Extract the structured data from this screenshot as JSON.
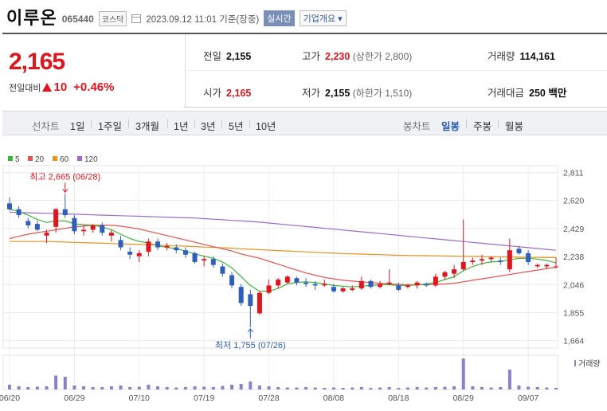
{
  "header": {
    "name": "이루온",
    "code": "065440",
    "market": "코스닥",
    "datetime": "2023.09.12 11:01 기준(장중)",
    "realtime_label": "실시간",
    "company_label": "기업개요 ▾"
  },
  "summary": {
    "price": "2,165",
    "change_label": "전일대비",
    "change_amount": "10",
    "change_percent": "+0.46%",
    "prev_close_label": "전일",
    "prev_close": "2,155",
    "high_label": "고가",
    "high": "2,230",
    "upper_limit": "(상한가 2,800)",
    "volume_label": "거래량",
    "volume": "114,161",
    "open_label": "시가",
    "open": "2,165",
    "low_label": "저가",
    "low": "2,155",
    "lower_limit": "(하한가 1,510)",
    "trade_value_label": "거래대금",
    "trade_value": "250 백만"
  },
  "period_bar": {
    "line_label": "선차트",
    "line_periods": [
      "1일",
      "1주일",
      "3개월",
      "1년",
      "3년",
      "5년",
      "10년"
    ],
    "candle_label": "봉차트",
    "candle_periods": [
      "일봉",
      "주봉",
      "월봉"
    ],
    "active_candle": "일봉"
  },
  "colors": {
    "up": "#e0151d",
    "down": "#2f5fb8",
    "ma5": "#3cb43c",
    "ma20": "#e8524f",
    "ma60": "#e8941e",
    "ma120": "#9b6ad0",
    "volume": "#8e80c4"
  },
  "chart_data": {
    "type": "candlestick",
    "legend": [
      "5",
      "20",
      "60",
      "120"
    ],
    "ylim": [
      1640,
      2830
    ],
    "yticks": [
      "2,811",
      "2,620",
      "2,429",
      "2,238",
      "2,046",
      "1,855",
      "1,664"
    ],
    "ytick_values": [
      2811,
      2620,
      2429,
      2238,
      2046,
      1855,
      1664
    ],
    "xticks": [
      "06/20",
      "06/29",
      "07/10",
      "07/19",
      "07/28",
      "08/08",
      "08/18",
      "08/29",
      "09/07"
    ],
    "xtick_index": [
      0,
      7,
      14,
      21,
      28,
      35,
      42,
      49,
      56
    ],
    "high_annotation": "최고 2,665 (06/28)",
    "low_annotation": "최저 1,755 (07/26)",
    "high_index": 6,
    "low_index": 26,
    "volume_label": "거래량",
    "candles": [
      {
        "o": 2600,
        "h": 2640,
        "l": 2550,
        "c": 2560
      },
      {
        "o": 2560,
        "h": 2580,
        "l": 2500,
        "c": 2520
      },
      {
        "o": 2480,
        "h": 2500,
        "l": 2430,
        "c": 2450
      },
      {
        "o": 2460,
        "h": 2480,
        "l": 2410,
        "c": 2420
      },
      {
        "o": 2380,
        "h": 2420,
        "l": 2330,
        "c": 2400
      },
      {
        "o": 2440,
        "h": 2570,
        "l": 2400,
        "c": 2560
      },
      {
        "o": 2560,
        "h": 2665,
        "l": 2500,
        "c": 2520
      },
      {
        "o": 2500,
        "h": 2520,
        "l": 2390,
        "c": 2410
      },
      {
        "o": 2410,
        "h": 2450,
        "l": 2380,
        "c": 2420
      },
      {
        "o": 2420,
        "h": 2460,
        "l": 2400,
        "c": 2450
      },
      {
        "o": 2450,
        "h": 2470,
        "l": 2380,
        "c": 2400
      },
      {
        "o": 2380,
        "h": 2420,
        "l": 2340,
        "c": 2400
      },
      {
        "o": 2350,
        "h": 2380,
        "l": 2280,
        "c": 2300
      },
      {
        "o": 2270,
        "h": 2300,
        "l": 2220,
        "c": 2250
      },
      {
        "o": 2240,
        "h": 2280,
        "l": 2200,
        "c": 2260
      },
      {
        "o": 2270,
        "h": 2360,
        "l": 2240,
        "c": 2340
      },
      {
        "o": 2340,
        "h": 2360,
        "l": 2280,
        "c": 2300
      },
      {
        "o": 2300,
        "h": 2330,
        "l": 2280,
        "c": 2310
      },
      {
        "o": 2300,
        "h": 2320,
        "l": 2260,
        "c": 2280
      },
      {
        "o": 2280,
        "h": 2300,
        "l": 2230,
        "c": 2250
      },
      {
        "o": 2260,
        "h": 2270,
        "l": 2190,
        "c": 2200
      },
      {
        "o": 2210,
        "h": 2240,
        "l": 2170,
        "c": 2220
      },
      {
        "o": 2220,
        "h": 2240,
        "l": 2160,
        "c": 2180
      },
      {
        "o": 2170,
        "h": 2190,
        "l": 2100,
        "c": 2120
      },
      {
        "o": 2110,
        "h": 2130,
        "l": 2020,
        "c": 2040
      },
      {
        "o": 2030,
        "h": 2050,
        "l": 1900,
        "c": 1920
      },
      {
        "o": 1980,
        "h": 2010,
        "l": 1755,
        "c": 1900
      },
      {
        "o": 1850,
        "h": 2000,
        "l": 1840,
        "c": 1990
      },
      {
        "o": 1990,
        "h": 2080,
        "l": 1980,
        "c": 2040
      },
      {
        "o": 2040,
        "h": 2090,
        "l": 2020,
        "c": 2080
      },
      {
        "o": 2060,
        "h": 2110,
        "l": 2050,
        "c": 2100
      },
      {
        "o": 2090,
        "h": 2100,
        "l": 2040,
        "c": 2060
      },
      {
        "o": 2060,
        "h": 2090,
        "l": 2030,
        "c": 2050
      },
      {
        "o": 2050,
        "h": 2070,
        "l": 2010,
        "c": 2040
      },
      {
        "o": 2040,
        "h": 2080,
        "l": 2030,
        "c": 2050
      },
      {
        "o": 2030,
        "h": 2050,
        "l": 1990,
        "c": 2000
      },
      {
        "o": 2000,
        "h": 2030,
        "l": 1990,
        "c": 2020
      },
      {
        "o": 2010,
        "h": 2040,
        "l": 2000,
        "c": 2020
      },
      {
        "o": 2020,
        "h": 2100,
        "l": 2010,
        "c": 2070
      },
      {
        "o": 2070,
        "h": 2080,
        "l": 2020,
        "c": 2030
      },
      {
        "o": 2030,
        "h": 2070,
        "l": 2020,
        "c": 2050
      },
      {
        "o": 2050,
        "h": 2150,
        "l": 2040,
        "c": 2060
      },
      {
        "o": 2040,
        "h": 2060,
        "l": 2000,
        "c": 2010
      },
      {
        "o": 2030,
        "h": 2050,
        "l": 2020,
        "c": 2040
      },
      {
        "o": 2040,
        "h": 2070,
        "l": 2020,
        "c": 2060
      },
      {
        "o": 2050,
        "h": 2060,
        "l": 2030,
        "c": 2040
      },
      {
        "o": 2040,
        "h": 2120,
        "l": 2030,
        "c": 2100
      },
      {
        "o": 2100,
        "h": 2140,
        "l": 2080,
        "c": 2130
      },
      {
        "o": 2120,
        "h": 2180,
        "l": 2090,
        "c": 2150
      },
      {
        "o": 2150,
        "h": 2490,
        "l": 2140,
        "c": 2200
      },
      {
        "o": 2200,
        "h": 2230,
        "l": 2180,
        "c": 2210
      },
      {
        "o": 2210,
        "h": 2250,
        "l": 2180,
        "c": 2220
      },
      {
        "o": 2220,
        "h": 2240,
        "l": 2200,
        "c": 2230
      },
      {
        "o": 2210,
        "h": 2230,
        "l": 2180,
        "c": 2200
      },
      {
        "o": 2150,
        "h": 2360,
        "l": 2130,
        "c": 2280
      },
      {
        "o": 2290,
        "h": 2310,
        "l": 2250,
        "c": 2260
      },
      {
        "o": 2260,
        "h": 2280,
        "l": 2180,
        "c": 2200
      },
      {
        "o": 2170,
        "h": 2190,
        "l": 2160,
        "c": 2180
      },
      {
        "o": 2170,
        "h": 2190,
        "l": 2150,
        "c": 2180
      },
      {
        "o": 2165,
        "h": 2230,
        "l": 2155,
        "c": 2170
      }
    ],
    "ma5": [
      2560,
      2545,
      2520,
      2490,
      2470,
      2480,
      2480,
      2460,
      2455,
      2450,
      2440,
      2420,
      2390,
      2360,
      2340,
      2330,
      2310,
      2300,
      2290,
      2275,
      2255,
      2240,
      2225,
      2200,
      2160,
      2100,
      2040,
      2000,
      2000,
      2020,
      2050,
      2060,
      2065,
      2060,
      2050,
      2040,
      2035,
      2030,
      2035,
      2040,
      2045,
      2045,
      2040,
      2040,
      2045,
      2050,
      2060,
      2080,
      2100,
      2140,
      2170,
      2190,
      2200,
      2205,
      2215,
      2225,
      2225,
      2220,
      2210,
      2195
    ],
    "ma20": [
      2360,
      2375,
      2390,
      2400,
      2410,
      2420,
      2430,
      2440,
      2445,
      2450,
      2452,
      2450,
      2445,
      2435,
      2425,
      2410,
      2395,
      2380,
      2365,
      2350,
      2335,
      2320,
      2305,
      2290,
      2275,
      2255,
      2240,
      2225,
      2205,
      2185,
      2165,
      2145,
      2125,
      2110,
      2095,
      2085,
      2075,
      2070,
      2065,
      2060,
      2055,
      2050,
      2048,
      2046,
      2045,
      2045,
      2048,
      2050,
      2055,
      2065,
      2075,
      2085,
      2095,
      2105,
      2115,
      2125,
      2135,
      2145,
      2155,
      2165
    ],
    "ma60": [
      2340,
      2340,
      2340,
      2340,
      2340,
      2338,
      2336,
      2334,
      2332,
      2330,
      2328,
      2326,
      2324,
      2322,
      2320,
      2318,
      2315,
      2312,
      2310,
      2308,
      2305,
      2302,
      2300,
      2297,
      2294,
      2290,
      2287,
      2284,
      2281,
      2278,
      2275,
      2272,
      2269,
      2266,
      2263,
      2260,
      2258,
      2256,
      2254,
      2252,
      2250,
      2248,
      2246,
      2245,
      2244,
      2243,
      2242,
      2241,
      2240,
      2239,
      2238,
      2237,
      2236,
      2235,
      2234,
      2233,
      2232,
      2231,
      2230,
      2230
    ],
    "ma120": [
      2540,
      2538,
      2536,
      2534,
      2532,
      2530,
      2528,
      2526,
      2524,
      2522,
      2520,
      2518,
      2516,
      2514,
      2512,
      2510,
      2508,
      2506,
      2504,
      2502,
      2500,
      2496,
      2492,
      2488,
      2484,
      2480,
      2476,
      2472,
      2466,
      2460,
      2454,
      2448,
      2442,
      2436,
      2430,
      2424,
      2418,
      2412,
      2406,
      2400,
      2394,
      2388,
      2382,
      2376,
      2370,
      2364,
      2358,
      2352,
      2346,
      2340,
      2334,
      2328,
      2322,
      2316,
      2310,
      2304,
      2298,
      2292,
      2286,
      2280
    ],
    "volumes": [
      12,
      8,
      6,
      7,
      8,
      35,
      32,
      10,
      8,
      6,
      6,
      8,
      10,
      6,
      7,
      12,
      8,
      6,
      5,
      6,
      8,
      7,
      6,
      9,
      12,
      14,
      20,
      10,
      8,
      6,
      5,
      5,
      6,
      5,
      4,
      5,
      4,
      5,
      6,
      4,
      5,
      6,
      4,
      5,
      6,
      5,
      6,
      7,
      8,
      78,
      8,
      6,
      5,
      6,
      50,
      10,
      7,
      6,
      5,
      4
    ]
  }
}
